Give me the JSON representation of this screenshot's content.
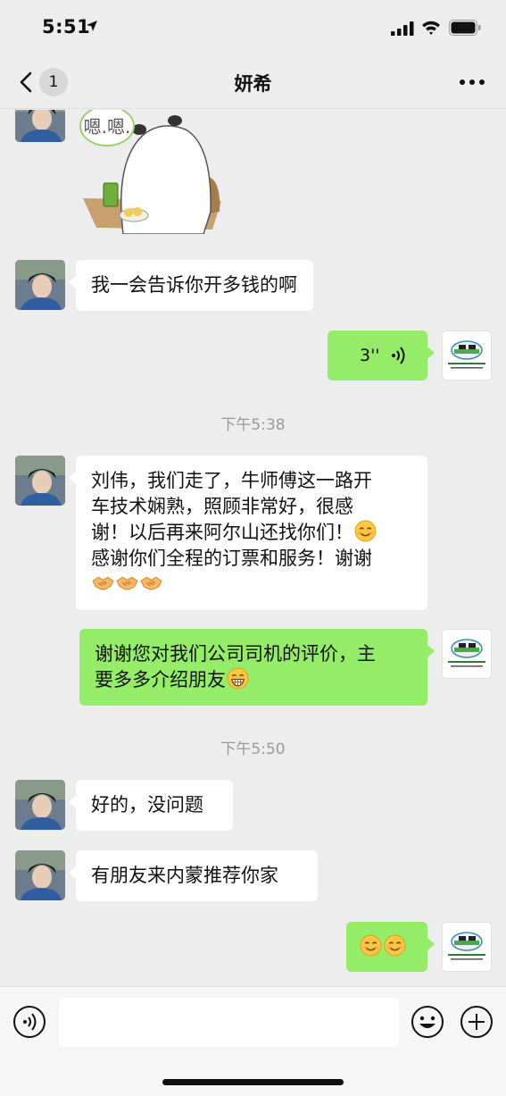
{
  "status_bar": {
    "time": "5:51"
  },
  "nav": {
    "unread_count": "1",
    "title": "妍希"
  },
  "sticker": {
    "bubble_text": "嗯.嗯."
  },
  "messages": {
    "m1": "我一会告诉你开多钱的啊",
    "voice_duration": "3''",
    "ts1": "下午5:38",
    "m3_line1": "刘伟，我们走了，牛师傅这一路开",
    "m3_line2": "车技术娴熟，照顾非常好，很感",
    "m3_line3": "谢！以后再来阿尔山还找你们！",
    "m3_line4": "感谢你们全程的订票和服务！谢谢",
    "m4_line1": "谢谢您对我们公司司机的评价，主",
    "m4_line2": "要多多介绍朋友",
    "ts2": "下午5:50",
    "m5": "好的，没问题",
    "m6": "有朋友来内蒙推荐你家"
  },
  "emojis": {
    "smile": "smile-emoji",
    "handshake": "handshake-emoji",
    "grin": "grin-emoji"
  },
  "colors": {
    "sent_bubble": "#95ec69",
    "received_bubble": "#ffffff",
    "background": "#ededed"
  }
}
